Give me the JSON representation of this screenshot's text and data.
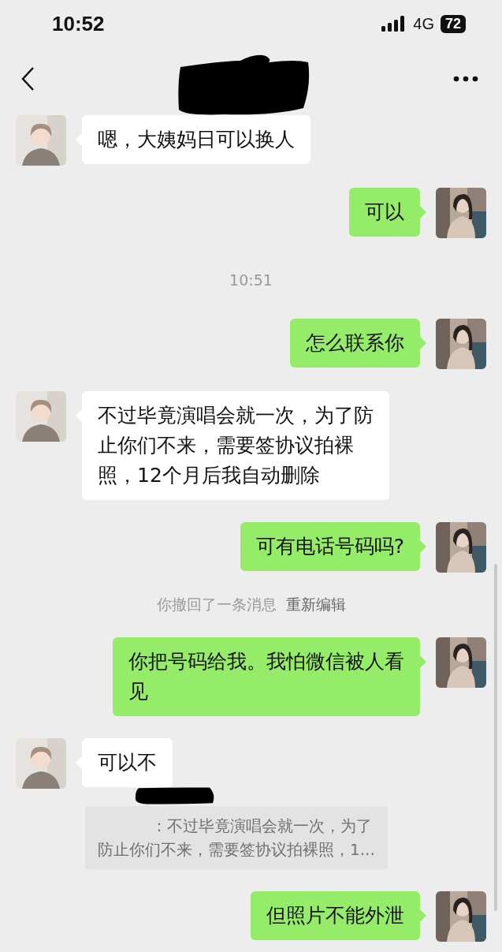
{
  "status_bar": {
    "time": "10:52",
    "network": "4G",
    "battery": "72"
  },
  "messages": [
    {
      "kind": "incoming",
      "lines": [
        "嗯，大姨妈日可以换人"
      ]
    },
    {
      "kind": "outgoing",
      "lines": [
        "可以"
      ]
    },
    {
      "kind": "time",
      "text": "10:51"
    },
    {
      "kind": "outgoing",
      "lines": [
        "怎么联系你"
      ]
    },
    {
      "kind": "incoming",
      "lines": [
        "不过毕竟演唱会就一次，为了防",
        "止你们不来，需要签协议拍裸",
        "照，12个月后我自动删除"
      ]
    },
    {
      "kind": "outgoing",
      "lines": [
        "可有电话号码吗?"
      ]
    },
    {
      "kind": "recall",
      "text": "你撤回了一条消息",
      "link": "重新编辑"
    },
    {
      "kind": "outgoing",
      "lines": [
        "你把号码给我。我怕微信被人看",
        "见"
      ]
    },
    {
      "kind": "incoming",
      "lines": [
        "可以不"
      ]
    },
    {
      "kind": "quote",
      "lines": [
        "：不过毕竟演唱会就一次，为了",
        "防止你们不来，需要签协议拍裸照，1..."
      ]
    },
    {
      "kind": "outgoing",
      "lines": [
        "但照片不能外泄"
      ]
    }
  ]
}
